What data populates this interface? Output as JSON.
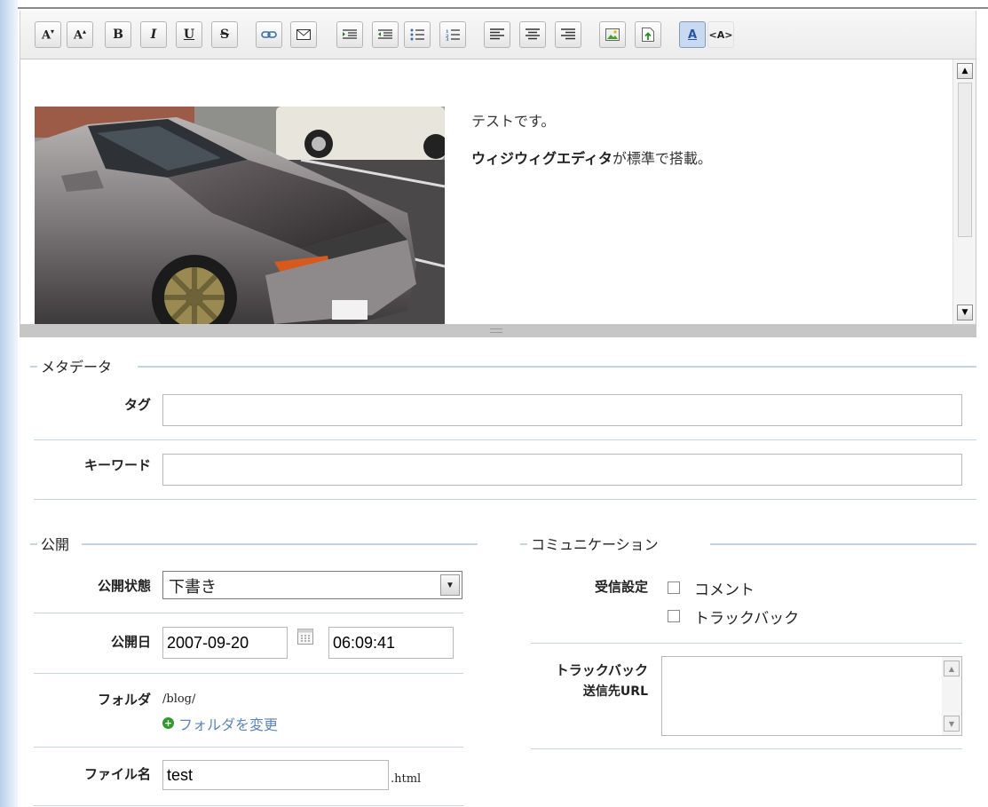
{
  "toolbar": {
    "buttons": [
      {
        "name": "font-decrease-icon",
        "glyph": "A↓"
      },
      {
        "name": "font-increase-icon",
        "glyph": "A↑"
      },
      {
        "name": "bold-icon",
        "glyph": "B"
      },
      {
        "name": "italic-icon",
        "glyph": "I"
      },
      {
        "name": "underline-icon",
        "glyph": "U"
      },
      {
        "name": "strikethrough-icon",
        "glyph": "S"
      },
      {
        "name": "link-icon",
        "glyph": "∞"
      },
      {
        "name": "email-icon",
        "glyph": "✉"
      },
      {
        "name": "indent-icon",
        "glyph": "⇥"
      },
      {
        "name": "outdent-icon",
        "glyph": "⇤"
      },
      {
        "name": "bullet-list-icon",
        "glyph": "•"
      },
      {
        "name": "numbered-list-icon",
        "glyph": "1"
      },
      {
        "name": "align-left-icon",
        "glyph": "≡"
      },
      {
        "name": "align-center-icon",
        "glyph": "≡"
      },
      {
        "name": "align-right-icon",
        "glyph": "≡"
      },
      {
        "name": "insert-image-icon",
        "glyph": "▣"
      },
      {
        "name": "insert-file-icon",
        "glyph": "▤"
      },
      {
        "name": "text-color-icon",
        "glyph": "A"
      },
      {
        "name": "html-source-icon",
        "glyph": "<A>"
      }
    ]
  },
  "editor": {
    "line1": "テストです。",
    "line2_bold": "ウィジウィグエディタ",
    "line2_rest": "が標準で搭載。"
  },
  "metadata": {
    "legend": "メタデータ",
    "tag_label": "タグ",
    "tag_value": "",
    "keyword_label": "キーワード",
    "keyword_value": ""
  },
  "publish": {
    "legend": "公開",
    "status_label": "公開状態",
    "status_value": "下書き",
    "date_label": "公開日",
    "date_value": "2007-09-20",
    "time_value": "06:09:41",
    "folder_label": "フォルダ",
    "folder_value": "/blog/",
    "change_folder_link": "フォルダを変更",
    "filename_label": "ファイル名",
    "filename_value": "test",
    "filename_ext": ".html"
  },
  "communication": {
    "legend": "コミュニケーション",
    "receive_label": "受信設定",
    "comment_label": "コメント",
    "comment_checked": false,
    "trackback_label": "トラックバック",
    "trackback_checked": false,
    "trackback_url_label_1": "トラックバック",
    "trackback_url_label_2": "送信先URL",
    "trackback_url_value": ""
  },
  "colors": {
    "accent": "#c5d4e4",
    "link": "#5b86b6"
  }
}
